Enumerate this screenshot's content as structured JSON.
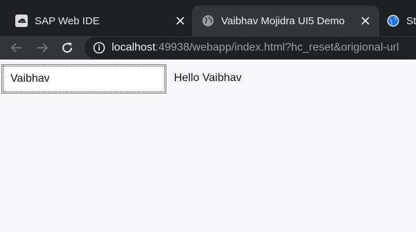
{
  "browser": {
    "tabs": [
      {
        "title": "SAP Web IDE",
        "icon": "sap-webide-icon",
        "active": false
      },
      {
        "title": "Vaibhav Mojidra UI5 Demo",
        "icon": "globe-icon",
        "active": true
      },
      {
        "title": "St",
        "icon": "chrome-globe-icon",
        "active": false
      }
    ],
    "url": {
      "host": "localhost",
      "rest": ":49938/webapp/index.html?hc_reset&origional-url"
    }
  },
  "page": {
    "name_input_value": "Vaibhav",
    "greeting_text": "Hello Vaibhav"
  },
  "colors": {
    "tabstrip_bg": "#1f2023",
    "active_tab_bg": "#35363a",
    "omnibox_bg": "#202124",
    "page_bg": "#f8f8fa"
  }
}
